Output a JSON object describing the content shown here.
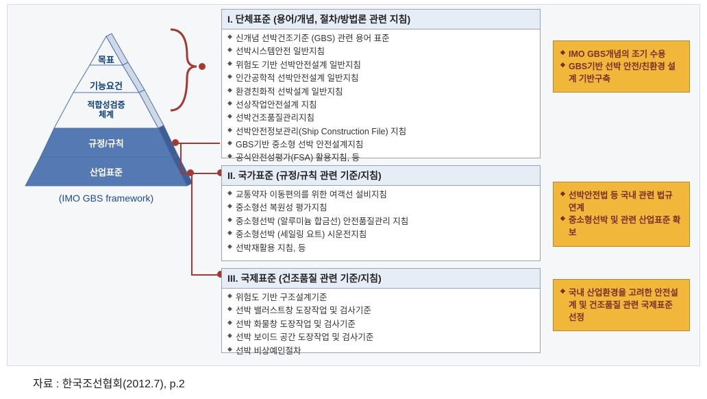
{
  "pyramid": {
    "levels": [
      {
        "label": "목표"
      },
      {
        "label": "기능요건"
      },
      {
        "label": "적합성검증\n체계"
      },
      {
        "label": "규정/규칙"
      },
      {
        "label": "산업표준"
      }
    ],
    "caption": "(IMO GBS framework)"
  },
  "sections": [
    {
      "header": "I. 단체표준 (용어/개념, 절차/방법론 관련 지침)",
      "items": [
        "신개념 선박건조기준 (GBS) 관련 용어 표준",
        "선박시스템안전 일반지침",
        "위험도 기반 선박안전설계 일반지침",
        "인간공학적 선박안전설계 일반지침",
        "환경친화적 선박설계 일반지침",
        "선상작업안전설계 지침",
        "선박건조품질관리지침",
        "선박안전정보관리(Ship Construction File) 지침",
        "GBS기반 중소형 선박 안전설계지침",
        "공식안전성평가(FSA) 활용지침, 등"
      ]
    },
    {
      "header": "II. 국가표준 (규정/규칙 관련 기준/지침)",
      "items": [
        "교통약자 이동편의를 위한 여객선 설비지침",
        "중소형선 복원성 평가지침",
        "중소형선박 (알루미늄 합금선) 안전품질관리 지침",
        "중소형선박 (세일링 요트) 시운전지침",
        "선박재활용 지침, 등"
      ]
    },
    {
      "header": "III. 국제표준 (건조품질 관련 기준/지침)",
      "items": [
        "위험도 기반 구조설계기준",
        "선박 밸러스트창 도장작업 및 검사기준",
        "선박 화물창 도장작업 및 검사기준",
        "선박 보이드 공간 도장작업 및 검사기준",
        "선박 비상예인절차"
      ]
    }
  ],
  "notes": [
    {
      "items": [
        "IMO GBS개념의 조기 수용",
        "GBS기반 선박 안전/친환경 설계 기반구축"
      ]
    },
    {
      "items": [
        "선박안전법 등 국내 관련 법규 연계",
        "중소형선박 및 관련 산업표준 확보"
      ]
    },
    {
      "items": [
        "국내 산업환경을 고려한 안전설계 및 건조품질 관련 국제표준 선정"
      ]
    }
  ],
  "source": "자료 : 한국조선협회(2012.7), p.2",
  "colors": {
    "pyr_top_fill": "#f4f6f8",
    "pyr_top_stroke": "#4f6ea7",
    "pyr_bottom_fill": "#5479b3",
    "red": "#a63832",
    "yellow": "#f0b73a"
  }
}
